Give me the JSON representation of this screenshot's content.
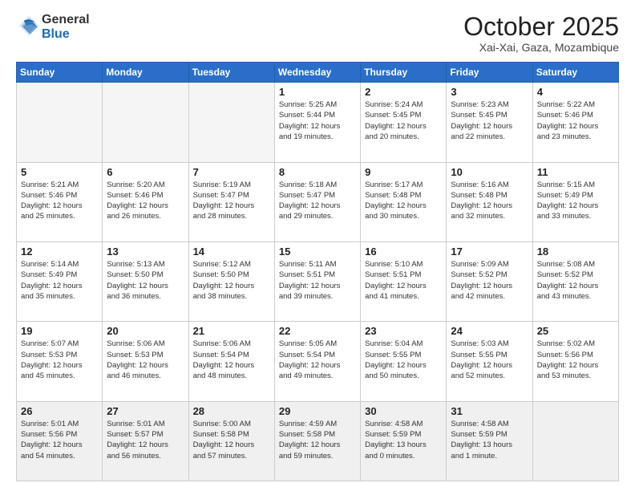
{
  "header": {
    "logo_general": "General",
    "logo_blue": "Blue",
    "month": "October 2025",
    "location": "Xai-Xai, Gaza, Mozambique"
  },
  "weekdays": [
    "Sunday",
    "Monday",
    "Tuesday",
    "Wednesday",
    "Thursday",
    "Friday",
    "Saturday"
  ],
  "weeks": [
    [
      {
        "day": "",
        "info": ""
      },
      {
        "day": "",
        "info": ""
      },
      {
        "day": "",
        "info": ""
      },
      {
        "day": "1",
        "info": "Sunrise: 5:25 AM\nSunset: 5:44 PM\nDaylight: 12 hours\nand 19 minutes."
      },
      {
        "day": "2",
        "info": "Sunrise: 5:24 AM\nSunset: 5:45 PM\nDaylight: 12 hours\nand 20 minutes."
      },
      {
        "day": "3",
        "info": "Sunrise: 5:23 AM\nSunset: 5:45 PM\nDaylight: 12 hours\nand 22 minutes."
      },
      {
        "day": "4",
        "info": "Sunrise: 5:22 AM\nSunset: 5:46 PM\nDaylight: 12 hours\nand 23 minutes."
      }
    ],
    [
      {
        "day": "5",
        "info": "Sunrise: 5:21 AM\nSunset: 5:46 PM\nDaylight: 12 hours\nand 25 minutes."
      },
      {
        "day": "6",
        "info": "Sunrise: 5:20 AM\nSunset: 5:46 PM\nDaylight: 12 hours\nand 26 minutes."
      },
      {
        "day": "7",
        "info": "Sunrise: 5:19 AM\nSunset: 5:47 PM\nDaylight: 12 hours\nand 28 minutes."
      },
      {
        "day": "8",
        "info": "Sunrise: 5:18 AM\nSunset: 5:47 PM\nDaylight: 12 hours\nand 29 minutes."
      },
      {
        "day": "9",
        "info": "Sunrise: 5:17 AM\nSunset: 5:48 PM\nDaylight: 12 hours\nand 30 minutes."
      },
      {
        "day": "10",
        "info": "Sunrise: 5:16 AM\nSunset: 5:48 PM\nDaylight: 12 hours\nand 32 minutes."
      },
      {
        "day": "11",
        "info": "Sunrise: 5:15 AM\nSunset: 5:49 PM\nDaylight: 12 hours\nand 33 minutes."
      }
    ],
    [
      {
        "day": "12",
        "info": "Sunrise: 5:14 AM\nSunset: 5:49 PM\nDaylight: 12 hours\nand 35 minutes."
      },
      {
        "day": "13",
        "info": "Sunrise: 5:13 AM\nSunset: 5:50 PM\nDaylight: 12 hours\nand 36 minutes."
      },
      {
        "day": "14",
        "info": "Sunrise: 5:12 AM\nSunset: 5:50 PM\nDaylight: 12 hours\nand 38 minutes."
      },
      {
        "day": "15",
        "info": "Sunrise: 5:11 AM\nSunset: 5:51 PM\nDaylight: 12 hours\nand 39 minutes."
      },
      {
        "day": "16",
        "info": "Sunrise: 5:10 AM\nSunset: 5:51 PM\nDaylight: 12 hours\nand 41 minutes."
      },
      {
        "day": "17",
        "info": "Sunrise: 5:09 AM\nSunset: 5:52 PM\nDaylight: 12 hours\nand 42 minutes."
      },
      {
        "day": "18",
        "info": "Sunrise: 5:08 AM\nSunset: 5:52 PM\nDaylight: 12 hours\nand 43 minutes."
      }
    ],
    [
      {
        "day": "19",
        "info": "Sunrise: 5:07 AM\nSunset: 5:53 PM\nDaylight: 12 hours\nand 45 minutes."
      },
      {
        "day": "20",
        "info": "Sunrise: 5:06 AM\nSunset: 5:53 PM\nDaylight: 12 hours\nand 46 minutes."
      },
      {
        "day": "21",
        "info": "Sunrise: 5:06 AM\nSunset: 5:54 PM\nDaylight: 12 hours\nand 48 minutes."
      },
      {
        "day": "22",
        "info": "Sunrise: 5:05 AM\nSunset: 5:54 PM\nDaylight: 12 hours\nand 49 minutes."
      },
      {
        "day": "23",
        "info": "Sunrise: 5:04 AM\nSunset: 5:55 PM\nDaylight: 12 hours\nand 50 minutes."
      },
      {
        "day": "24",
        "info": "Sunrise: 5:03 AM\nSunset: 5:55 PM\nDaylight: 12 hours\nand 52 minutes."
      },
      {
        "day": "25",
        "info": "Sunrise: 5:02 AM\nSunset: 5:56 PM\nDaylight: 12 hours\nand 53 minutes."
      }
    ],
    [
      {
        "day": "26",
        "info": "Sunrise: 5:01 AM\nSunset: 5:56 PM\nDaylight: 12 hours\nand 54 minutes."
      },
      {
        "day": "27",
        "info": "Sunrise: 5:01 AM\nSunset: 5:57 PM\nDaylight: 12 hours\nand 56 minutes."
      },
      {
        "day": "28",
        "info": "Sunrise: 5:00 AM\nSunset: 5:58 PM\nDaylight: 12 hours\nand 57 minutes."
      },
      {
        "day": "29",
        "info": "Sunrise: 4:59 AM\nSunset: 5:58 PM\nDaylight: 12 hours\nand 59 minutes."
      },
      {
        "day": "30",
        "info": "Sunrise: 4:58 AM\nSunset: 5:59 PM\nDaylight: 13 hours\nand 0 minutes."
      },
      {
        "day": "31",
        "info": "Sunrise: 4:58 AM\nSunset: 5:59 PM\nDaylight: 13 hours\nand 1 minute."
      },
      {
        "day": "",
        "info": ""
      }
    ]
  ]
}
